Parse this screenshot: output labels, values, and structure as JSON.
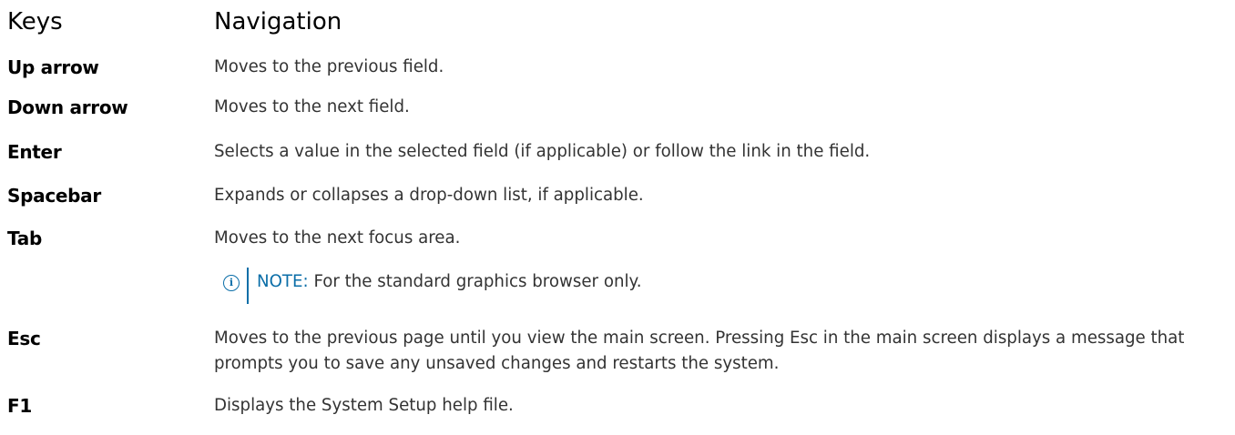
{
  "table": {
    "headers": {
      "keys": "Keys",
      "navigation": "Navigation"
    },
    "rows": [
      {
        "key": "Up arrow",
        "description": "Moves to the previous field."
      },
      {
        "key": "Down arrow",
        "description": "Moves to the next field."
      },
      {
        "key": "Enter",
        "description": "Selects a value in the selected field (if applicable) or follow the link in the field."
      },
      {
        "key": "Spacebar",
        "description": "Expands or collapses a drop-down list, if applicable."
      },
      {
        "key": "Tab",
        "description": "Moves to the next focus area."
      },
      {
        "key": "Esc",
        "description": "Moves to the previous page until you view the main screen. Pressing Esc in the main screen displays a message that prompts you to save any unsaved changes and restarts the system."
      },
      {
        "key": "F1",
        "description": "Displays the System Setup help file."
      }
    ],
    "note": {
      "icon": "info-icon",
      "label": "NOTE:",
      "text": " For the standard graphics browser only."
    }
  },
  "colors": {
    "note_accent": "#0b6ea8",
    "heading": "#000000",
    "body_text": "#333333"
  }
}
